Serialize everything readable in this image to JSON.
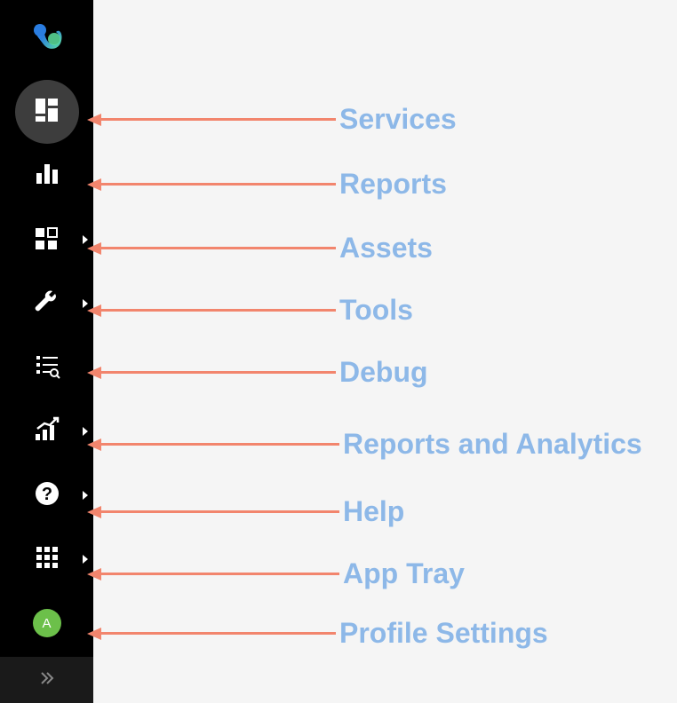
{
  "sidebar": {
    "logo_alt": "Webex logo",
    "items": [
      {
        "id": "services",
        "active": true,
        "has_chevron": false
      },
      {
        "id": "reports",
        "active": false,
        "has_chevron": false
      },
      {
        "id": "assets",
        "active": false,
        "has_chevron": true
      },
      {
        "id": "tools",
        "active": false,
        "has_chevron": true
      },
      {
        "id": "debug",
        "active": false,
        "has_chevron": false
      },
      {
        "id": "reports-analytics",
        "active": false,
        "has_chevron": true
      },
      {
        "id": "help",
        "active": false,
        "has_chevron": true
      },
      {
        "id": "app-tray",
        "active": false,
        "has_chevron": true
      },
      {
        "id": "profile",
        "active": false,
        "has_chevron": false
      }
    ],
    "avatar_initial": "A"
  },
  "annotations": {
    "services": "Services",
    "reports": "Reports",
    "assets": "Assets",
    "tools": "Tools",
    "debug": "Debug",
    "reports_analytics": "Reports and Analytics",
    "help": "Help",
    "app_tray": "App Tray",
    "profile": "Profile Settings"
  }
}
